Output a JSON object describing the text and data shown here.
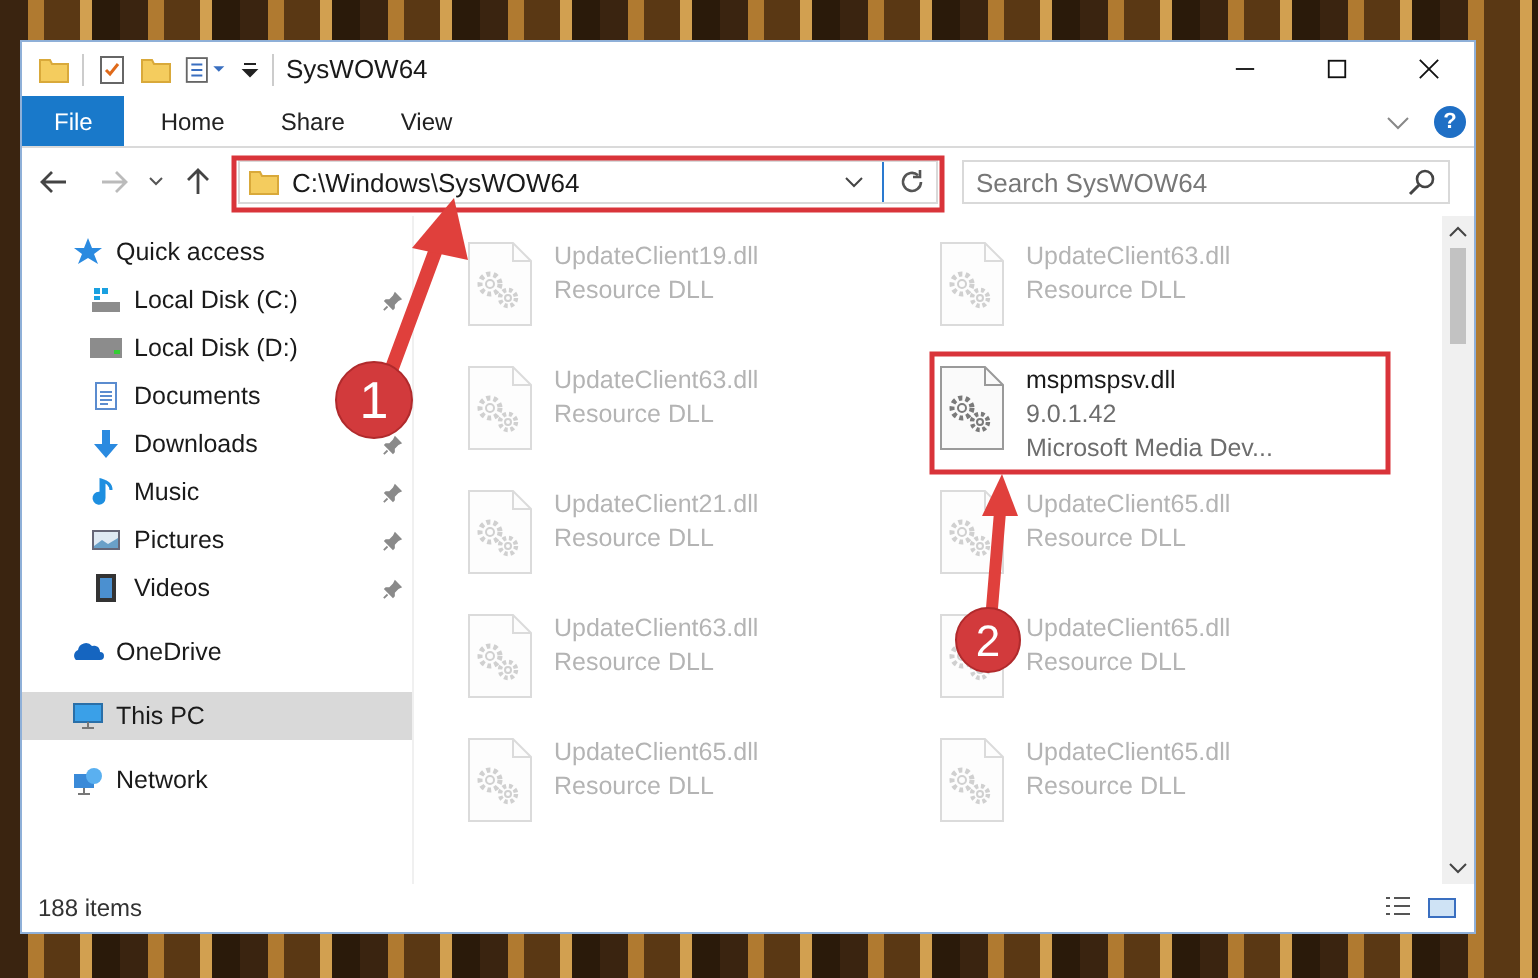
{
  "window": {
    "title": "SysWOW64"
  },
  "ribbon_tabs": [
    {
      "label": "File",
      "selected": true
    },
    {
      "label": "Home",
      "selected": false
    },
    {
      "label": "Share",
      "selected": false
    },
    {
      "label": "View",
      "selected": false
    }
  ],
  "address_bar": {
    "path": "C:\\Windows\\SysWOW64"
  },
  "help_button": {
    "label": "?"
  },
  "search": {
    "placeholder": "Search SysWOW64"
  },
  "sidebar": {
    "items": [
      {
        "label": "Quick access",
        "kind": "star",
        "selected": false,
        "children": [
          {
            "label": "Local Disk (C:)",
            "kind": "system-drive",
            "pinned": true,
            "selected": false
          },
          {
            "label": "Local Disk (D:)",
            "kind": "drive",
            "pinned": false,
            "selected": false
          },
          {
            "label": "Documents",
            "kind": "documents",
            "pinned": false,
            "selected": false
          },
          {
            "label": "Downloads",
            "kind": "downloads",
            "pinned": true,
            "selected": false
          },
          {
            "label": "Music",
            "kind": "music",
            "pinned": true,
            "selected": false
          },
          {
            "label": "Pictures",
            "kind": "pictures",
            "pinned": true,
            "selected": false
          },
          {
            "label": "Videos",
            "kind": "videos",
            "pinned": true,
            "selected": false
          }
        ]
      },
      {
        "label": "OneDrive",
        "kind": "cloud",
        "selected": false
      },
      {
        "label": "This PC",
        "kind": "computer",
        "selected": true
      },
      {
        "label": "Network",
        "kind": "network",
        "selected": false
      }
    ]
  },
  "files": [
    {
      "name": "UpdateClient19.dll",
      "line_2": "Resource DLL",
      "faded": true
    },
    {
      "name": "UpdateClient63.dll",
      "line_2": "Resource DLL",
      "faded": true
    },
    {
      "name": "UpdateClient63.dll",
      "line_2": "Resource DLL",
      "faded": true
    },
    {
      "name": "mspmspsv.dll",
      "line_2": "9.0.1.42",
      "line_3": "Microsoft Media Dev...",
      "faded": false
    },
    {
      "name": "UpdateClient21.dll",
      "line_2": "Resource DLL",
      "faded": true
    },
    {
      "name": "UpdateClient65.dll",
      "line_2": "Resource DLL",
      "faded": true
    },
    {
      "name": "UpdateClient63.dll",
      "line_2": "Resource DLL",
      "faded": true
    },
    {
      "name": "UpdateClient65.dll",
      "line_2": "Resource DLL",
      "faded": true
    },
    {
      "name": "UpdateClient65.dll",
      "line_2": "Resource DLL",
      "faded": true
    },
    {
      "name": "UpdateClient65.dll",
      "line_2": "Resource DLL",
      "faded": true
    }
  ],
  "status_bar": {
    "item_count": "188 items"
  },
  "annotations": [
    {
      "label": "1"
    },
    {
      "label": "2"
    }
  ]
}
